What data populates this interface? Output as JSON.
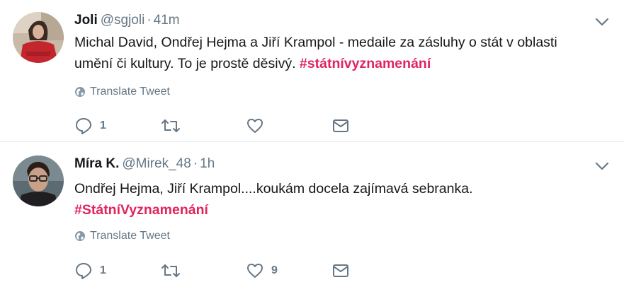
{
  "tweets": [
    {
      "fullname": "Joli",
      "username": "@sgjoli",
      "separator": "·",
      "time": "41m",
      "text_plain": "Michal David, Ondřej Hejma a Jiří Krampol - medaile za zásluhy o stát v oblasti umění či kultury. To je prostě děsivý. ",
      "hashtag": "#státnívyznamenání",
      "translate_label": "Translate Tweet",
      "reply_count": "1",
      "retweet_count": "",
      "like_count": "",
      "avatar_icon": "avatar-photo-red-sweater"
    },
    {
      "fullname": "Míra K.",
      "username": "@Mirek_48",
      "separator": "·",
      "time": "1h",
      "text_plain": "Ondřej Hejma, Jiří Krampol....koukám docela zajímavá sebranka.",
      "hashtag": "#StátníVyznamenání",
      "translate_label": "Translate Tweet",
      "reply_count": "1",
      "retweet_count": "",
      "like_count": "9",
      "avatar_icon": "avatar-photo-man-glasses"
    }
  ],
  "icons": {
    "reply": "reply-icon",
    "retweet": "retweet-icon",
    "like": "heart-icon",
    "dm": "envelope-icon",
    "caret": "chevron-down-icon",
    "globe": "globe-icon"
  },
  "colors": {
    "hashtag": "#e0245e",
    "secondary_text": "#657786",
    "primary_text": "#14171a",
    "divider": "#e6ecf0"
  }
}
